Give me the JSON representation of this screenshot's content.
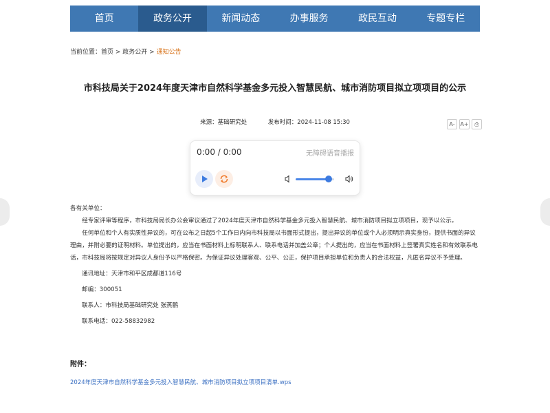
{
  "nav": {
    "items": [
      {
        "label": "首页"
      },
      {
        "label": "政务公开",
        "active": true
      },
      {
        "label": "新闻动态"
      },
      {
        "label": "办事服务"
      },
      {
        "label": "政民互动"
      },
      {
        "label": "专题专栏"
      }
    ]
  },
  "breadcrumb": {
    "prefix": "当前位置：",
    "items": [
      "首页",
      "政务公开",
      "通知公告"
    ],
    "separator": " > "
  },
  "article": {
    "title": "市科技局关于2024年度天津市自然科学基金多元投入智慧民航、城市消防项目拟立项项目的公示",
    "source": "来源：基础研究处",
    "publish_time": "发布时间：2024-11-08 15:30"
  },
  "tools": {
    "decrease_font": "A-",
    "increase_font": "A+",
    "print": "⎙"
  },
  "player": {
    "time": "0:00 / 0:00",
    "label": "无障碍语音播报",
    "volume_level": 0.85
  },
  "body": {
    "salutation": "各有关单位：",
    "p1": "经专家评审等程序，市科技局局长办公会审议通过了2024年度天津市自然科学基金多元投入智慧民航、城市消防项目拟立项项目，现予以公示。",
    "p2": "任何单位和个人有实质性异议的，可在公布之日起5个工作日内向市科技局以书面形式提出，提出异议的单位或个人必须明示真实身份，提供书面的异议理由，并附必要的证明材料。单位提出的，应当在书面材料上标明联系人、联系电话并加盖公章；个人提出的，应当在书面材料上签署真实姓名和有效联系电话，市科技局将按规定对异议人身份予以严格保密。为保证异议处理客观、公平、公正，保护项目承担单位和负责人的合法权益，凡匿名异议不予受理。",
    "address": "通讯地址：天津市和平区成都道116号",
    "postcode": "邮编：300051",
    "contact": "联系人：市科技局基础研究处 张蒸鹏",
    "phone": "联系电话：022-58832982"
  },
  "attachment": {
    "title": "附件：",
    "link_text": "2024年度天津市自然科学基金多元投入智慧民航、城市消防项目拟立项项目清单.wps"
  },
  "colors": {
    "nav_bg": "#3f78b3",
    "nav_active": "#2a5b8e",
    "link": "#3a6fc2",
    "breadcrumb_current": "#d8731a"
  }
}
